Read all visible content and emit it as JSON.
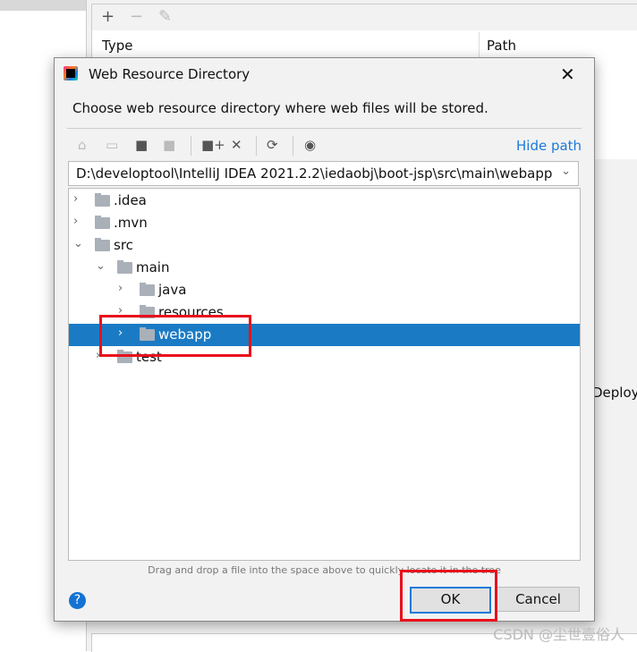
{
  "background": {
    "toolbar_icons": [
      "plus-icon",
      "minus-icon",
      "pencil-icon"
    ],
    "columns": [
      "Type",
      "Path"
    ],
    "deploy_label": "Deploy"
  },
  "dialog": {
    "title": "Web Resource Directory",
    "subtitle": "Choose web resource directory where web files will be stored.",
    "toolbar": [
      "home-icon",
      "desktop-icon",
      "project-folder-icon",
      "module-folder-icon",
      "new-folder-icon",
      "delete-icon",
      "refresh-icon",
      "show-hidden-icon"
    ],
    "hide_path": "Hide path",
    "path": "D:\\developtool\\IntelliJ IDEA 2021.2.2\\iedaobj\\boot-jsp\\src\\main\\webapp",
    "tree": [
      {
        "label": ".idea",
        "depth": 0,
        "expanded": false
      },
      {
        "label": ".mvn",
        "depth": 0,
        "expanded": false
      },
      {
        "label": "src",
        "depth": 0,
        "expanded": true
      },
      {
        "label": "main",
        "depth": 1,
        "expanded": true
      },
      {
        "label": "java",
        "depth": 2,
        "expanded": false
      },
      {
        "label": "resources",
        "depth": 2,
        "expanded": false
      },
      {
        "label": "webapp",
        "depth": 2,
        "expanded": false,
        "selected": true
      },
      {
        "label": "test",
        "depth": 1,
        "expanded": false
      }
    ],
    "hint": "Drag and drop a file into the space above to quickly locate it in the tree",
    "help": "?",
    "ok": "OK",
    "cancel": "Cancel",
    "selection_color": "#1a7bc4",
    "highlight_color": "#e8111c"
  },
  "watermark": "CSDN @尘世壹俗人"
}
